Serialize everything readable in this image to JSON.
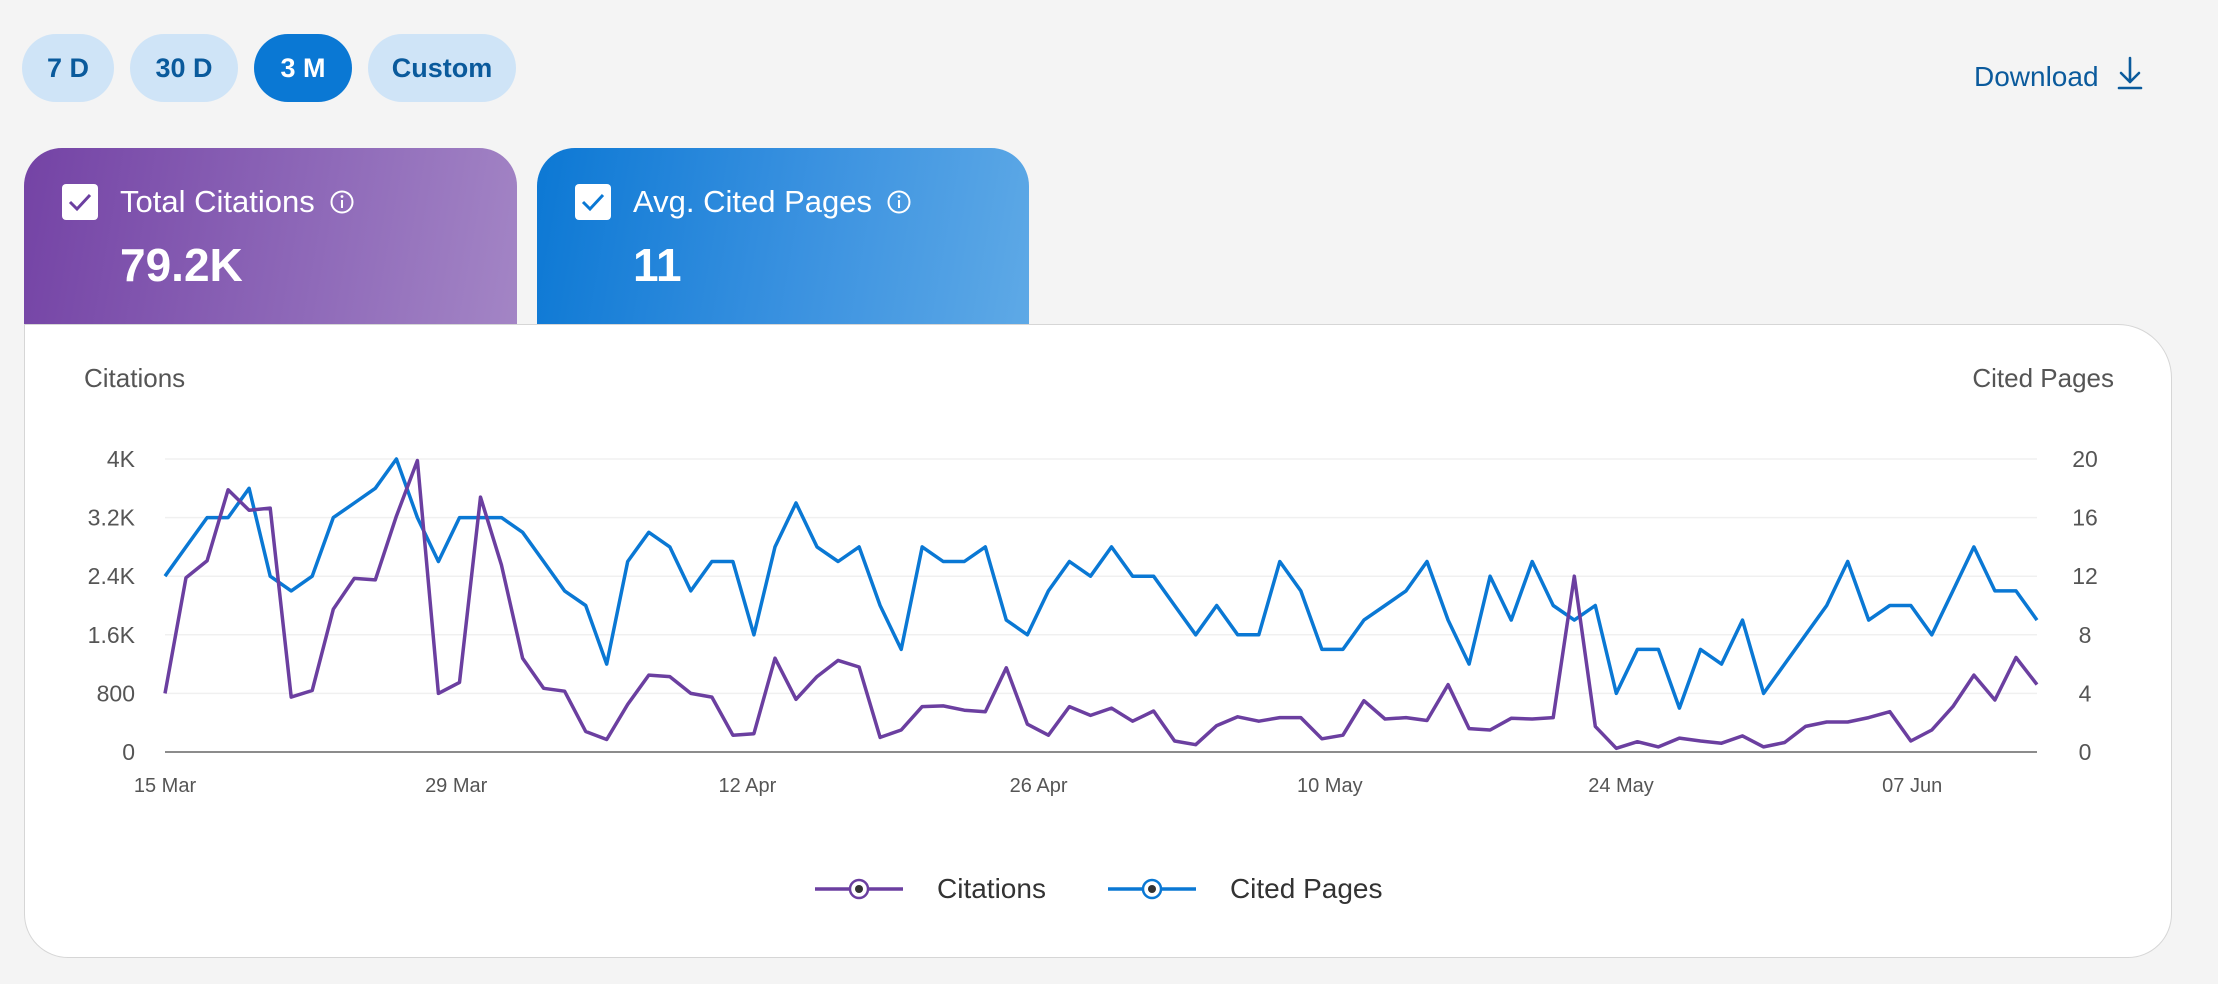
{
  "ranges": [
    {
      "label": "7 D",
      "active": false
    },
    {
      "label": "30 D",
      "active": false
    },
    {
      "label": "3 M",
      "active": true
    },
    {
      "label": "Custom",
      "active": false
    }
  ],
  "download_label": "Download",
  "cards": {
    "citations": {
      "title": "Total Citations",
      "value": "79.2K",
      "checked": true
    },
    "pages": {
      "title": "Avg. Cited Pages",
      "value": "11",
      "checked": true
    }
  },
  "colors": {
    "citations": "#6b3fa0",
    "pages": "#0a78d4"
  },
  "chart_data": {
    "type": "line",
    "ylabel": "Citations",
    "y2label": "Cited Pages",
    "ylim": [
      0,
      4000
    ],
    "y2lim": [
      0,
      20
    ],
    "yticks": [
      "0",
      "800",
      "1.6K",
      "2.4K",
      "3.2K",
      "4K"
    ],
    "y2ticks": [
      "0",
      "4",
      "8",
      "12",
      "16",
      "20"
    ],
    "xticks": [
      "15 Mar",
      "29 Mar",
      "12 Apr",
      "26 Apr",
      "10 May",
      "24 May",
      "07 Jun"
    ],
    "x_start": "2025-03-15",
    "x_end": "2025-06-13",
    "legend_position": "bottom",
    "series": [
      {
        "name": "Citations",
        "axis": "left",
        "values": [
          800,
          2380,
          2610,
          3580,
          3300,
          3330,
          750,
          840,
          1950,
          2370,
          2350,
          3220,
          3980,
          800,
          950,
          3480,
          2550,
          1280,
          870,
          830,
          280,
          170,
          650,
          1050,
          1030,
          800,
          750,
          230,
          250,
          1280,
          720,
          1030,
          1250,
          1160,
          200,
          300,
          620,
          630,
          570,
          550,
          1150,
          380,
          230,
          620,
          500,
          600,
          420,
          560,
          150,
          100,
          360,
          480,
          420,
          470,
          470,
          180,
          230,
          700,
          450,
          470,
          430,
          920,
          320,
          300,
          460,
          450,
          470,
          2400,
          350,
          50,
          140,
          70,
          190,
          150,
          120,
          220,
          70,
          130,
          350,
          410,
          410,
          470,
          550,
          150,
          300,
          620,
          1050,
          710,
          1290,
          920
        ]
      },
      {
        "name": "Cited Pages",
        "axis": "right",
        "values": [
          12,
          14,
          16,
          16,
          18,
          12,
          11,
          12,
          16,
          17,
          18,
          20,
          16,
          13,
          16,
          16,
          16,
          15,
          13,
          11,
          10,
          6,
          13,
          15,
          14,
          11,
          13,
          13,
          8,
          14,
          17,
          14,
          13,
          14,
          10,
          7,
          14,
          13,
          13,
          14,
          9,
          8,
          11,
          13,
          12,
          14,
          12,
          12,
          10,
          8,
          10,
          8,
          8,
          13,
          11,
          7,
          7,
          9,
          10,
          11,
          13,
          9,
          6,
          12,
          9,
          13,
          10,
          9,
          10,
          4,
          7,
          7,
          3,
          7,
          6,
          9,
          4,
          6,
          8,
          10,
          13,
          9,
          10,
          10,
          8,
          11,
          14,
          11,
          11,
          9
        ]
      }
    ]
  }
}
